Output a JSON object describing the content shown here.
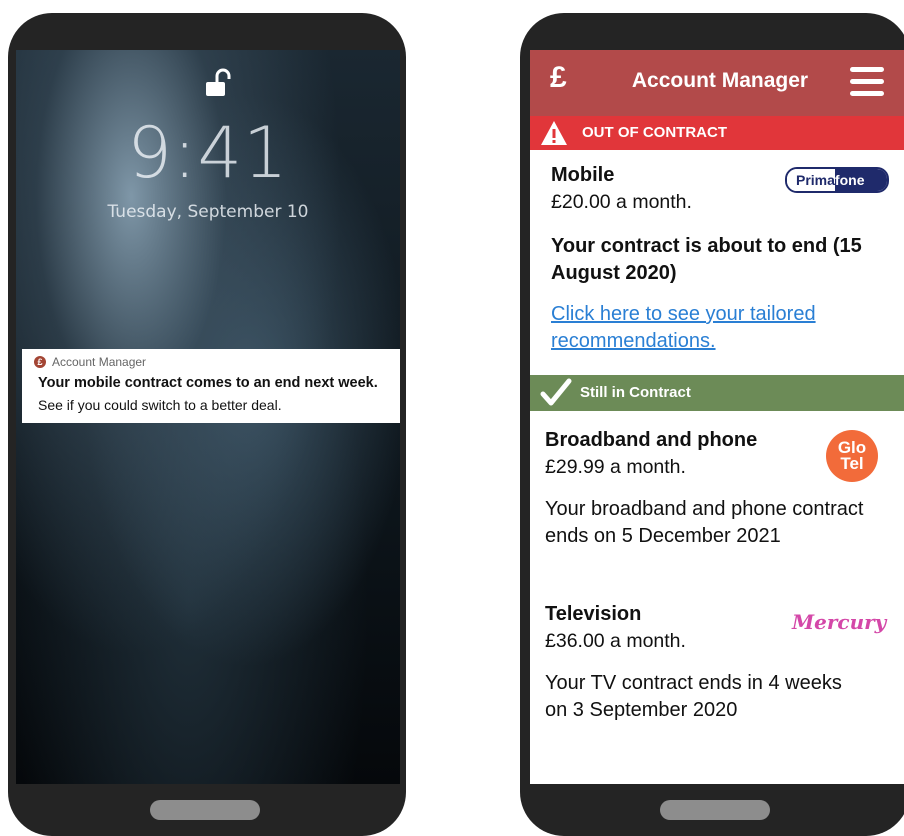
{
  "lock_screen": {
    "time": "9:41",
    "date": "Tuesday, September 10",
    "notification": {
      "app_name": "Account Manager",
      "app_icon": "pound-icon",
      "title": "Your mobile contract comes to an end next week.",
      "body": "See if you could switch to a better deal."
    }
  },
  "app": {
    "logo": "£",
    "title": "Account Manager",
    "out_of_contract": {
      "banner_label": "OUT OF CONTRACT",
      "color": "#e1363a",
      "service_name": "Mobile",
      "price": "£20.00 a month.",
      "provider_logo": {
        "left": "Prima",
        "right": "fone"
      },
      "notice": "Your contract is about to end (15 August 2020)",
      "link_text": "Click here to see your tailored recommendations."
    },
    "in_contract": {
      "banner_label": "Still in Contract",
      "color": "#6c8b57",
      "services": [
        {
          "name": "Broadband and phone",
          "price": "£29.99 a month.",
          "provider": {
            "line1": "Glo",
            "line2": "Tel"
          },
          "description": "Your broadband and phone contract ends on 5 December 2021"
        },
        {
          "name": "Television",
          "price": "£36.00 a month.",
          "provider": {
            "name": "Mercury"
          },
          "description": "Your TV contract ends in 4 weeks on 3 September 2020"
        }
      ]
    }
  },
  "colors": {
    "header": "#b24a4a",
    "link": "#2a7fd4",
    "phone_frame": "#242424"
  }
}
